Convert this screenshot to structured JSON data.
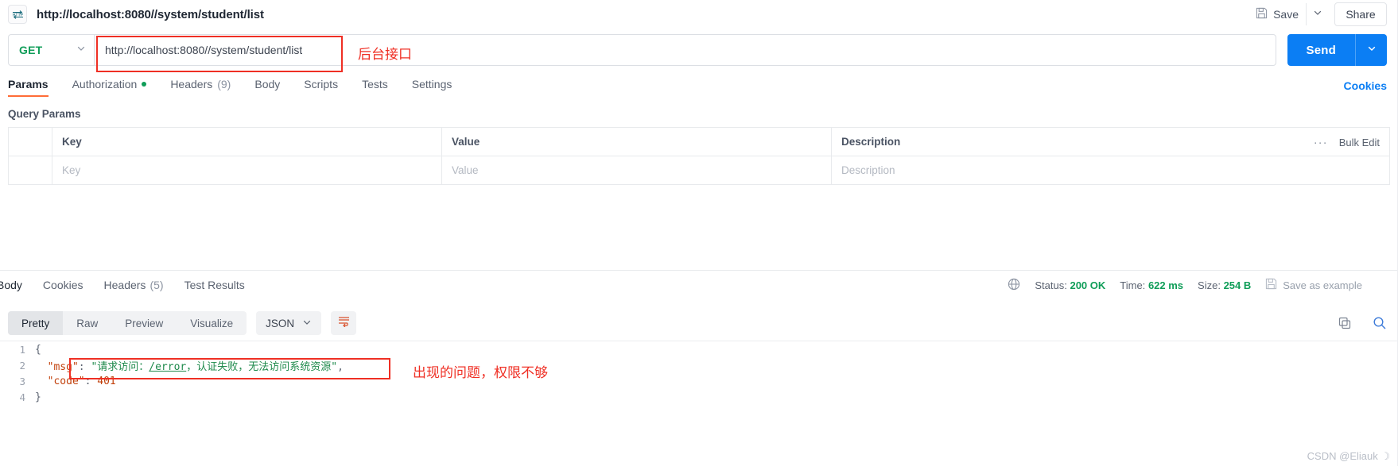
{
  "titlebar": {
    "protocol_icon": "http-icon",
    "tab_title": "http://localhost:8080//system/student/list",
    "save_label": "Save",
    "save_icon": "floppy-disk-icon",
    "save_caret_icon": "chevron-down-icon",
    "share_label": "Share"
  },
  "request": {
    "method": "GET",
    "method_caret_icon": "chevron-down-icon",
    "url": "http://localhost:8080//system/student/list",
    "send_label": "Send",
    "send_caret_icon": "chevron-down-icon",
    "annotation_url": "后台接口"
  },
  "request_tabs": {
    "items": [
      {
        "label": "Params",
        "active": true,
        "dot": false,
        "count": ""
      },
      {
        "label": "Authorization",
        "active": false,
        "dot": true,
        "count": ""
      },
      {
        "label": "Headers",
        "active": false,
        "dot": false,
        "count": "(9)"
      },
      {
        "label": "Body",
        "active": false,
        "dot": false,
        "count": ""
      },
      {
        "label": "Scripts",
        "active": false,
        "dot": false,
        "count": ""
      },
      {
        "label": "Tests",
        "active": false,
        "dot": false,
        "count": ""
      },
      {
        "label": "Settings",
        "active": false,
        "dot": false,
        "count": ""
      }
    ],
    "cookies_link": "Cookies"
  },
  "query_params": {
    "section_title": "Query Params",
    "columns": [
      "Key",
      "Value",
      "Description"
    ],
    "rows": [
      {
        "key": "Key",
        "value": "Value",
        "description": "Description"
      }
    ],
    "dots_label": "···",
    "bulk_edit_label": "Bulk Edit"
  },
  "response": {
    "tabs": [
      {
        "label": "Body",
        "active": true,
        "count": ""
      },
      {
        "label": "Cookies",
        "active": false,
        "count": ""
      },
      {
        "label": "Headers",
        "active": false,
        "count": "(5)"
      },
      {
        "label": "Test Results",
        "active": false,
        "count": ""
      }
    ],
    "globe_icon": "globe-icon",
    "status_label": "Status:",
    "status_value": "200 OK",
    "time_label": "Time:",
    "time_value": "622 ms",
    "size_label": "Size:",
    "size_value": "254 B",
    "save_example_label": "Save as example",
    "save_example_icon": "floppy-disk-icon",
    "more_icon": "ellipsis-icon",
    "view_modes": [
      {
        "label": "Pretty",
        "active": true
      },
      {
        "label": "Raw",
        "active": false
      },
      {
        "label": "Preview",
        "active": false
      },
      {
        "label": "Visualize",
        "active": false
      }
    ],
    "format_select": "JSON",
    "format_caret_icon": "chevron-down-icon",
    "wrap_icon": "word-wrap-icon",
    "copy_icon": "copy-icon",
    "search_icon": "search-icon",
    "annotation_body": "出现的问题，权限不够",
    "body_lines": [
      {
        "num": "1",
        "indent": 0,
        "segments": [
          {
            "t": "{",
            "c": "tok-punct"
          }
        ]
      },
      {
        "num": "2",
        "indent": 1,
        "segments": [
          {
            "t": "\"msg\"",
            "c": "tok-key"
          },
          {
            "t": ": ",
            "c": "tok-punct"
          },
          {
            "t": "\"请求访问：",
            "c": "tok-str"
          },
          {
            "t": "/error",
            "c": "tok-url"
          },
          {
            "t": "，认证失败，无法访问系统资源\"",
            "c": "tok-str"
          },
          {
            "t": ",",
            "c": "tok-punct"
          }
        ]
      },
      {
        "num": "3",
        "indent": 1,
        "segments": [
          {
            "t": "\"code\"",
            "c": "tok-key"
          },
          {
            "t": ": ",
            "c": "tok-punct"
          },
          {
            "t": "401",
            "c": "tok-num"
          }
        ]
      },
      {
        "num": "4",
        "indent": 0,
        "segments": [
          {
            "t": "}",
            "c": "tok-punct"
          }
        ]
      }
    ]
  },
  "watermark": "CSDN @Eliauk  ☽",
  "colors": {
    "accent_orange": "#ff6c37",
    "send_blue": "#0b7ef4",
    "method_green": "#0f9d58",
    "annotation_red": "#ef2f24",
    "link_blue": "#0b7ef4"
  }
}
